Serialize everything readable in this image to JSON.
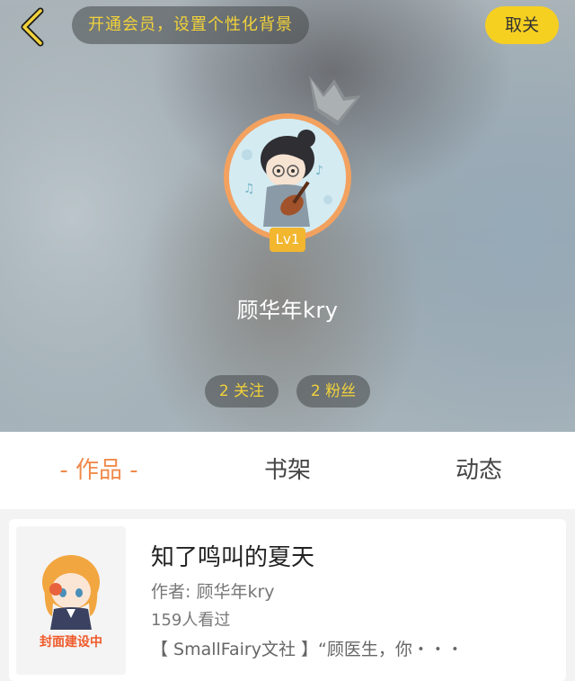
{
  "header": {
    "vip_banner": "开通会员，设置个性化背景",
    "unfollow_label": "取关",
    "level": "Lv1",
    "username": "顾华年kry",
    "following": "2 关注",
    "fans": "2 粉丝"
  },
  "tabs": {
    "works": "- 作品 -",
    "bookshelf": "书架",
    "activity": "动态"
  },
  "book": {
    "cover_label": "封面建设中",
    "title": "知了鸣叫的夏天",
    "author": "作者: 顾华年kry",
    "views": "159人看过",
    "description": "【 SmallFairy文社 】“顾医生，你・・・"
  },
  "icons": {
    "back": "chevron-left-icon",
    "crown": "crown-icon"
  },
  "colors": {
    "accent_yellow": "#f6d021",
    "banner_text": "#f2d23b",
    "tab_active": "#f08a4b",
    "avatar_ring": "#f3a15f",
    "level_badge": "#f2b62f"
  }
}
